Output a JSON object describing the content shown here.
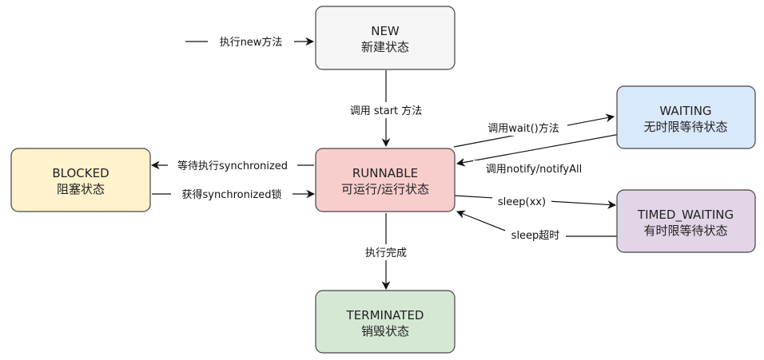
{
  "nodes": {
    "new": {
      "line1": "NEW",
      "line2": "新建状态",
      "fill": "#f5f5f5",
      "stroke": "#666666"
    },
    "runnable": {
      "line1": "RUNNABLE",
      "line2": "可运行/运行状态",
      "fill": "#f8cecc",
      "stroke": "#b85450"
    },
    "blocked": {
      "line1": "BLOCKED",
      "line2": "阻塞状态",
      "fill": "#fff2cc",
      "stroke": "#d6b656"
    },
    "waiting": {
      "line1": "WAITING",
      "line2": "无时限等待状态",
      "fill": "#dae8fc",
      "stroke": "#6c8ebf"
    },
    "timed_waiting": {
      "line1": "TIMED_WAITING",
      "line2": "有时限等待状态",
      "fill": "#e1d5e7",
      "stroke": "#9673a6"
    },
    "terminated": {
      "line1": "TERMINATED",
      "line2": "销毁状态",
      "fill": "#d5e8d4",
      "stroke": "#82b366"
    }
  },
  "edges": {
    "exec_new": "执行new方法",
    "call_start": "调用 start 方法",
    "call_wait": "调用wait()方法",
    "call_notify": "调用notify/notifyAll",
    "wait_sync": "等待执行synchronized",
    "get_sync": "获得synchronized锁",
    "sleep": "sleep(xx)",
    "sleep_timeout": "sleep超时",
    "exec_done": "执行完成"
  }
}
